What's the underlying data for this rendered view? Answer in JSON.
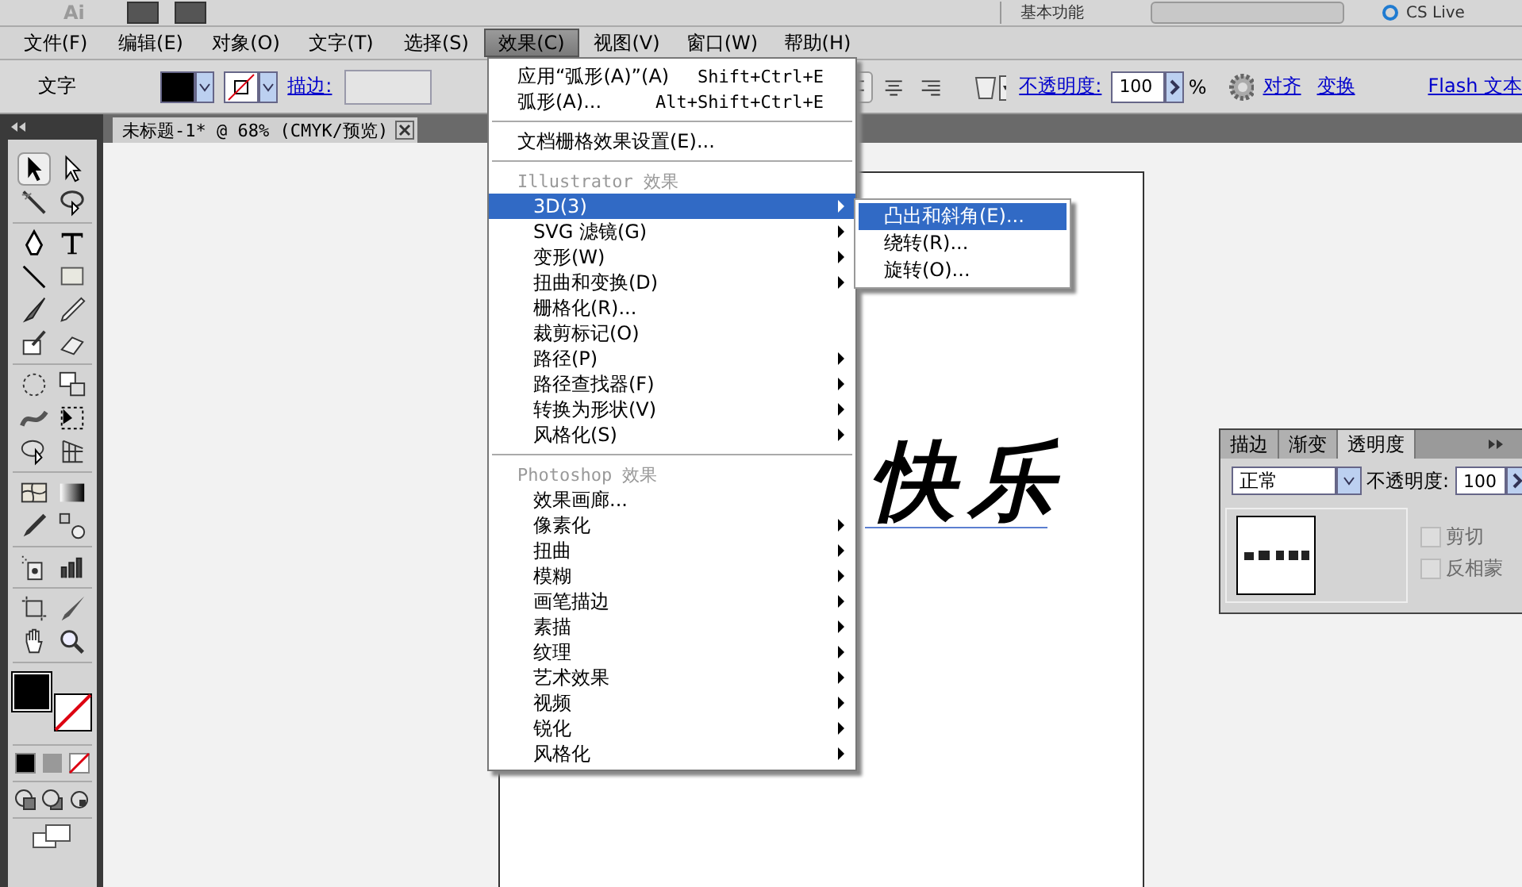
{
  "app_bar": {
    "logo": "Ai",
    "workspace": "基本功能",
    "cs_live": "CS Live"
  },
  "menu_bar": [
    {
      "label": "文件(F)",
      "selected": false
    },
    {
      "label": "编辑(E)",
      "selected": false
    },
    {
      "label": "对象(O)",
      "selected": false
    },
    {
      "label": "文字(T)",
      "selected": false
    },
    {
      "label": "选择(S)",
      "selected": false
    },
    {
      "label": "效果(C)",
      "selected": true
    },
    {
      "label": "视图(V)",
      "selected": false
    },
    {
      "label": "窗口(W)",
      "selected": false
    },
    {
      "label": "帮助(H)",
      "selected": false
    }
  ],
  "control_bar": {
    "object_type": "文字",
    "stroke_link": "描边:",
    "alignment": [
      {
        "kind": "left",
        "selected": true
      },
      {
        "kind": "center",
        "selected": false
      },
      {
        "kind": "right",
        "selected": false
      }
    ],
    "opacity_link": "不透明度:",
    "opacity_value": "100",
    "percent": "%",
    "align_link": "对齐",
    "transform_link": "变换",
    "flash_text_link": "Flash 文本"
  },
  "document_tab": {
    "title": "未标题-1* @ 68% (CMYK/预览)"
  },
  "artboard": {
    "text": "快乐"
  },
  "effect_menu": {
    "items": [
      {
        "kind": "item",
        "label": "应用“弧形(A)”(A)",
        "shortcut": "Shift+Ctrl+E",
        "has_submenu": false,
        "selected": false
      },
      {
        "kind": "item",
        "label": "弧形(A)...",
        "shortcut": "Alt+Shift+Ctrl+E",
        "has_submenu": false,
        "selected": false
      },
      {
        "kind": "separator"
      },
      {
        "kind": "item",
        "label": "文档栅格效果设置(E)...",
        "has_submenu": false,
        "selected": false
      },
      {
        "kind": "separator"
      },
      {
        "kind": "header",
        "label": "Illustrator 效果"
      },
      {
        "kind": "sub",
        "label": "3D(3)",
        "has_submenu": true,
        "selected": true
      },
      {
        "kind": "sub",
        "label": "SVG 滤镜(G)",
        "has_submenu": true,
        "selected": false
      },
      {
        "kind": "sub",
        "label": "变形(W)",
        "has_submenu": true,
        "selected": false
      },
      {
        "kind": "sub",
        "label": "扭曲和变换(D)",
        "has_submenu": true,
        "selected": false
      },
      {
        "kind": "sub",
        "label": "栅格化(R)...",
        "has_submenu": false,
        "selected": false
      },
      {
        "kind": "sub",
        "label": "裁剪标记(O)",
        "has_submenu": false,
        "selected": false
      },
      {
        "kind": "sub",
        "label": "路径(P)",
        "has_submenu": true,
        "selected": false
      },
      {
        "kind": "sub",
        "label": "路径查找器(F)",
        "has_submenu": true,
        "selected": false
      },
      {
        "kind": "sub",
        "label": "转换为形状(V)",
        "has_submenu": true,
        "selected": false
      },
      {
        "kind": "sub",
        "label": "风格化(S)",
        "has_submenu": true,
        "selected": false
      },
      {
        "kind": "separator"
      },
      {
        "kind": "header",
        "label": "Photoshop 效果"
      },
      {
        "kind": "sub",
        "label": "效果画廊...",
        "has_submenu": false,
        "selected": false
      },
      {
        "kind": "sub",
        "label": "像素化",
        "has_submenu": true,
        "selected": false
      },
      {
        "kind": "sub",
        "label": "扭曲",
        "has_submenu": true,
        "selected": false
      },
      {
        "kind": "sub",
        "label": "模糊",
        "has_submenu": true,
        "selected": false
      },
      {
        "kind": "sub",
        "label": "画笔描边",
        "has_submenu": true,
        "selected": false
      },
      {
        "kind": "sub",
        "label": "素描",
        "has_submenu": true,
        "selected": false
      },
      {
        "kind": "sub",
        "label": "纹理",
        "has_submenu": true,
        "selected": false
      },
      {
        "kind": "sub",
        "label": "艺术效果",
        "has_submenu": true,
        "selected": false
      },
      {
        "kind": "sub",
        "label": "视频",
        "has_submenu": true,
        "selected": false
      },
      {
        "kind": "sub",
        "label": "锐化",
        "has_submenu": true,
        "selected": false
      },
      {
        "kind": "sub",
        "label": "风格化",
        "has_submenu": true,
        "selected": false
      }
    ]
  },
  "submenu_3d": {
    "items": [
      {
        "label": "凸出和斜角(E)...",
        "selected": true
      },
      {
        "label": "绕转(R)...",
        "selected": false
      },
      {
        "label": "旋转(O)...",
        "selected": false
      }
    ]
  },
  "transparency_panel": {
    "tabs": [
      {
        "label": "描边",
        "selected": false
      },
      {
        "label": "渐变",
        "selected": false
      },
      {
        "label": "透明度",
        "selected": true
      }
    ],
    "blend_mode": "正常",
    "opacity_label": "不透明度:",
    "opacity_value": "100",
    "options": [
      {
        "label": "剪切",
        "checked": false,
        "disabled": true
      },
      {
        "label": "反相蒙",
        "checked": false,
        "disabled": true
      }
    ]
  }
}
